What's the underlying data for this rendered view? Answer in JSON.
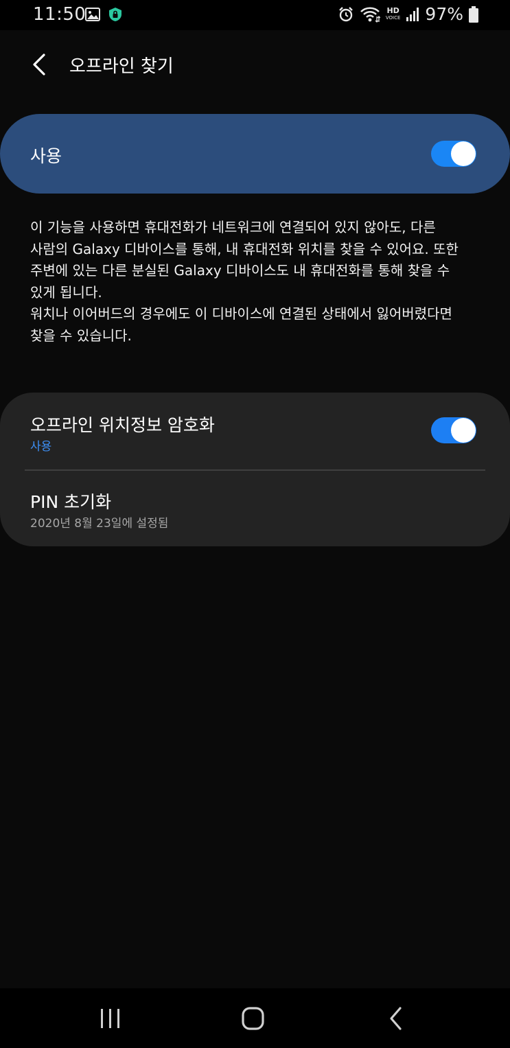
{
  "status_bar": {
    "time": "11:50",
    "battery": "97%",
    "hd_label": "HD",
    "hd_sub": "VOICE",
    "icons": [
      "gallery-icon",
      "secure-folder-icon",
      "alarm-icon",
      "wifi-icon",
      "hd-voice-icon",
      "signal-icon",
      "battery-icon"
    ]
  },
  "header": {
    "title": "오프라인 찾기",
    "back_icon": "chevron-left-icon"
  },
  "master_switch": {
    "label": "사용",
    "enabled": true
  },
  "description": {
    "lines": [
      "이 기능을 사용하면 휴대전화가 네트워크에 연결되어 있지 않아도, 다른",
      "사람의 Galaxy 디바이스를 통해, 내 휴대전화 위치를 찾을 수 있어요. 또한",
      "주변에 있는 다른 분실된 Galaxy 디바이스도 내 휴대전화를 통해 찾을 수",
      "있게 됩니다.",
      "워치나 이어버드의 경우에도 이 디바이스에 연결된 상태에서 잃어버렸다면",
      "찾을 수 있습니다."
    ]
  },
  "settings": {
    "encrypt": {
      "title": "오프라인 위치정보 암호화",
      "subtitle": "사용",
      "enabled": true
    },
    "pin": {
      "title": "PIN 초기화",
      "subtitle": "2020년 8월 23일에 설정됨"
    }
  },
  "nav_bar": {
    "buttons": [
      "recents-icon",
      "home-icon",
      "back-icon"
    ]
  },
  "colors": {
    "background": "#0a0a0a",
    "master_card": "#2c4d7c",
    "settings_card": "#232323",
    "toggle_on": "#1a86f5",
    "accent_text": "#3d8ff5"
  }
}
